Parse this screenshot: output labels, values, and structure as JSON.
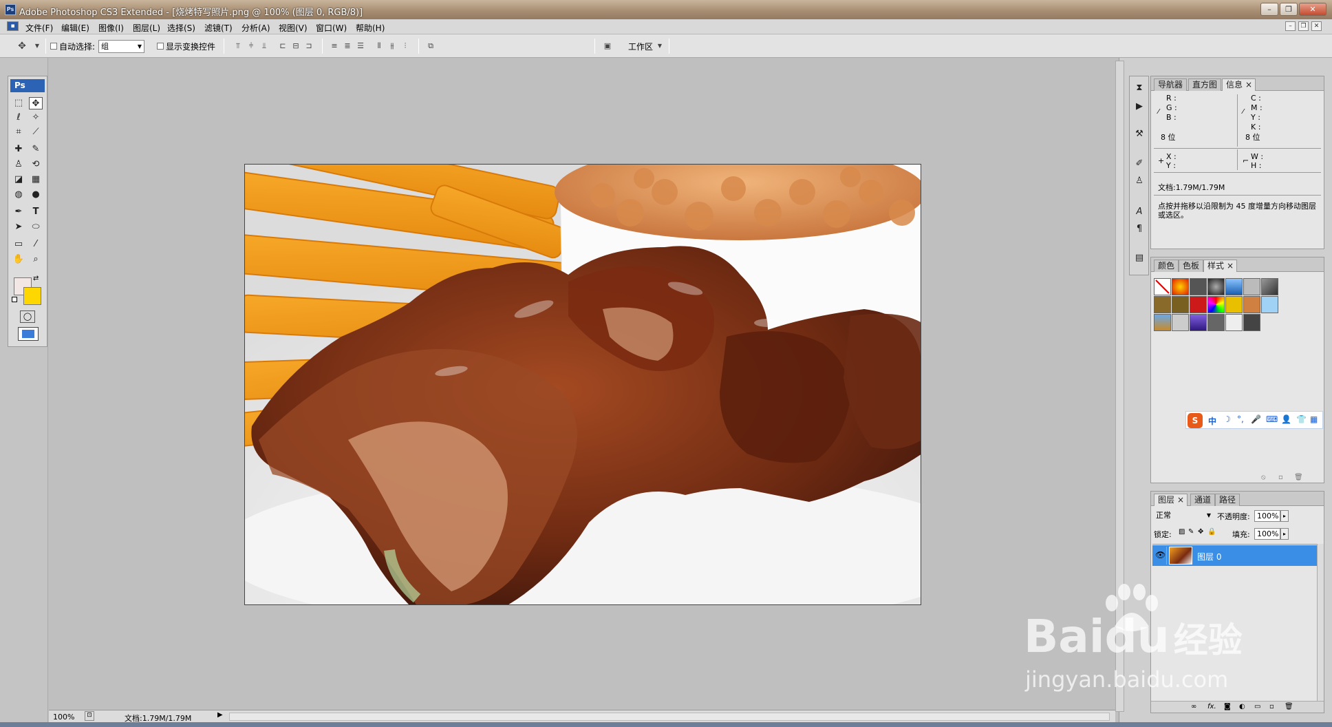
{
  "window": {
    "title": "Adobe Photoshop CS3 Extended - [烧烤特写照片.png @ 100% (图层 0, RGB/8)]",
    "app_badge": "Ps"
  },
  "menu": [
    "文件(F)",
    "编辑(E)",
    "图像(I)",
    "图层(L)",
    "选择(S)",
    "滤镜(T)",
    "分析(A)",
    "视图(V)",
    "窗口(W)",
    "帮助(H)"
  ],
  "options": {
    "auto_select_label": "自动选择:",
    "auto_select_value": "组",
    "show_transform_label": "显示变换控件",
    "workspace_label": "工作区"
  },
  "toolbox": {
    "badge": "Ps"
  },
  "panels": {
    "info": {
      "tabs": [
        "导航器",
        "直方图",
        "信息"
      ],
      "rgb": [
        "R :",
        "G :",
        "B :"
      ],
      "cmyk": [
        "C :",
        "M :",
        "Y :",
        "K :"
      ],
      "bits_left": "8 位",
      "bits_right": "8 位",
      "xy": [
        "X :",
        "Y :"
      ],
      "wh": [
        "W :",
        "H :"
      ],
      "doc": "文档:1.79M/1.79M",
      "hint": "点按并拖移以沿限制为 45 度增量方向移动图层或选区。"
    },
    "styles": {
      "tabs": [
        "颜色",
        "色板",
        "样式"
      ]
    },
    "layers": {
      "tabs": [
        "图层",
        "通道",
        "路径"
      ],
      "blend_mode": "正常",
      "opacity_label": "不透明度:",
      "opacity_value": "100%",
      "lock_label": "锁定:",
      "fill_label": "填充:",
      "fill_value": "100%",
      "layer_name": "图层 0"
    }
  },
  "ime": {
    "badge": "S",
    "items": [
      "中"
    ]
  },
  "statusbar": {
    "zoom": "100%",
    "doc": "文档:1.79M/1.79M"
  },
  "watermark": {
    "line1": "Baidu",
    "line1b": "经验",
    "line2": "jingyan.baidu.com"
  },
  "colors": {
    "layer_selected": "#3a8ee6",
    "foreground": "#f2e7e4",
    "background": "#ffd700"
  }
}
